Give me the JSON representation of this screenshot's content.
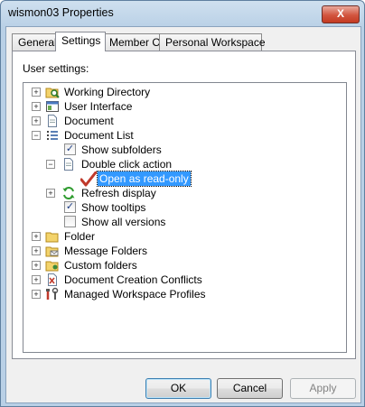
{
  "window": {
    "title": "wismon03 Properties",
    "close_glyph": "X"
  },
  "tabs": [
    {
      "label": "General",
      "active": false
    },
    {
      "label": "Settings",
      "active": true
    },
    {
      "label": "Member Of",
      "active": false
    },
    {
      "label": "Personal Workspace",
      "active": false
    }
  ],
  "settings": {
    "section_label": "User settings:",
    "tree": [
      {
        "label": "Working Directory",
        "expander": "+",
        "icon": "folder-search-icon"
      },
      {
        "label": "User Interface",
        "expander": "+",
        "icon": "window-icon"
      },
      {
        "label": "Document",
        "expander": "+",
        "icon": "document-icon"
      },
      {
        "label": "Document List",
        "expander": "-",
        "icon": "list-icon"
      },
      {
        "label": "Show subfolders",
        "checkbox": true
      },
      {
        "label": "Double click action",
        "expander": "-",
        "icon": "document-icon"
      },
      {
        "label": "Open as read-only",
        "selected": true,
        "icon": "checkmark-icon"
      },
      {
        "label": "Refresh display",
        "expander": "+",
        "icon": "refresh-icon"
      },
      {
        "label": "Show tooltips",
        "checkbox": true
      },
      {
        "label": "Show all versions",
        "checkbox": false
      },
      {
        "label": "Folder",
        "expander": "+",
        "icon": "folder-icon"
      },
      {
        "label": "Message Folders",
        "expander": "+",
        "icon": "message-folder-icon"
      },
      {
        "label": "Custom folders",
        "expander": "+",
        "icon": "custom-folder-icon"
      },
      {
        "label": "Document Creation Conflicts",
        "expander": "+",
        "icon": "conflict-document-icon"
      },
      {
        "label": "Managed Workspace Profiles",
        "expander": "+",
        "icon": "tools-icon"
      }
    ]
  },
  "buttons": {
    "ok": "OK",
    "cancel": "Cancel",
    "apply": "Apply"
  },
  "colors": {
    "selection": "#3399ff",
    "check": "#c0392b",
    "folder": "#f3d36b"
  }
}
